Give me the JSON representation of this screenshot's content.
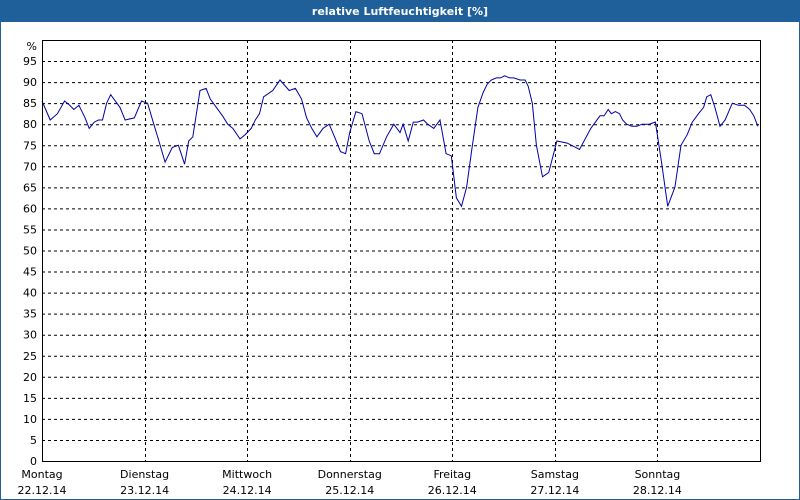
{
  "chart_data": {
    "type": "line",
    "title": "relative Luftfeuchtigkeit [%]",
    "ylabel": "%",
    "ylim": [
      0,
      100
    ],
    "yticks": [
      0,
      5,
      10,
      15,
      20,
      25,
      30,
      35,
      40,
      45,
      50,
      55,
      60,
      65,
      70,
      75,
      80,
      85,
      90,
      95
    ],
    "xlim": [
      0,
      7
    ],
    "x_tick_labels": [
      {
        "day": "Montag",
        "date": "22.12.14"
      },
      {
        "day": "Dienstag",
        "date": "23.12.14"
      },
      {
        "day": "Mittwoch",
        "date": "24.12.14"
      },
      {
        "day": "Donnerstag",
        "date": "25.12.14"
      },
      {
        "day": "Freitag",
        "date": "26.12.14"
      },
      {
        "day": "Samstag",
        "date": "27.12.14"
      },
      {
        "day": "Sonntag",
        "date": "28.12.14"
      }
    ],
    "grid": true,
    "colors": {
      "line": "#0000aa",
      "title_bar": "#1f5f9a",
      "grid": "#000000"
    },
    "series": [
      {
        "x": [
          0.0,
          0.08,
          0.15,
          0.22,
          0.27,
          0.31,
          0.36,
          0.42,
          0.46,
          0.51,
          0.55,
          0.59,
          0.63,
          0.67,
          0.76,
          0.81,
          0.9,
          0.97,
          1.03,
          1.09,
          1.14,
          1.2,
          1.27,
          1.33,
          1.39,
          1.43,
          1.47,
          1.54,
          1.6,
          1.64,
          1.7,
          1.76,
          1.81,
          1.86,
          1.93,
          1.98,
          2.04,
          2.08,
          2.12,
          2.16,
          2.25,
          2.32,
          2.41,
          2.47,
          2.53,
          2.58,
          2.63,
          2.68,
          2.74,
          2.8,
          2.86,
          2.91,
          2.96,
          3.0,
          3.06,
          3.12,
          3.19,
          3.24,
          3.29,
          3.36,
          3.43,
          3.49,
          3.52,
          3.57,
          3.62,
          3.66,
          3.72,
          3.76,
          3.82,
          3.88,
          3.94,
          3.99,
          4.04,
          4.09,
          4.14,
          4.19,
          4.25,
          4.3,
          4.34,
          4.38,
          4.43,
          4.47,
          4.51,
          4.56,
          4.6,
          4.66,
          4.71,
          4.74,
          4.78,
          4.82,
          4.88,
          4.94,
          5.02,
          5.12,
          5.24,
          5.35,
          5.44,
          5.48,
          5.52,
          5.55,
          5.59,
          5.63,
          5.66,
          5.7,
          5.75,
          5.8,
          5.85,
          5.92,
          5.98,
          6.04,
          6.1,
          6.17,
          6.23,
          6.29,
          6.34,
          6.4,
          6.45,
          6.48,
          6.52,
          6.56,
          6.61,
          6.66,
          6.73,
          6.79,
          6.85,
          6.9,
          6.94,
          6.98
        ],
        "y": [
          85.5,
          81,
          82.5,
          85.5,
          84.5,
          83.5,
          84.5,
          81.5,
          79,
          80.5,
          81,
          81,
          85,
          87,
          84,
          81,
          81.5,
          85.5,
          85,
          80,
          76,
          71,
          74.5,
          75,
          70.5,
          76,
          77,
          88,
          88.5,
          86,
          84,
          82,
          80,
          79,
          76.5,
          77.5,
          79,
          81,
          82.5,
          86.5,
          88,
          90.5,
          88,
          88.5,
          86,
          81.5,
          79,
          77,
          79,
          80,
          76.5,
          73.5,
          73,
          78,
          83,
          82.5,
          76,
          73,
          73,
          77,
          80,
          78,
          80,
          76,
          80.5,
          80.5,
          81,
          80,
          79,
          81,
          73,
          72.5,
          62.5,
          60.5,
          65,
          74,
          84,
          87.5,
          89.5,
          90.5,
          91,
          91,
          91.5,
          91,
          91,
          90.5,
          90.5,
          89,
          85,
          75,
          67.5,
          68.5,
          76,
          75.5,
          74,
          79,
          82,
          82,
          83.5,
          82.5,
          83,
          82.5,
          81,
          80,
          79.5,
          79.5,
          80,
          80,
          80.5,
          71,
          60.5,
          65,
          75,
          77.5,
          80.5,
          82.5,
          84,
          86.5,
          87,
          84,
          79.5,
          81,
          85,
          84.5,
          84.5,
          83.5,
          82,
          79.5
        ]
      }
    ]
  }
}
